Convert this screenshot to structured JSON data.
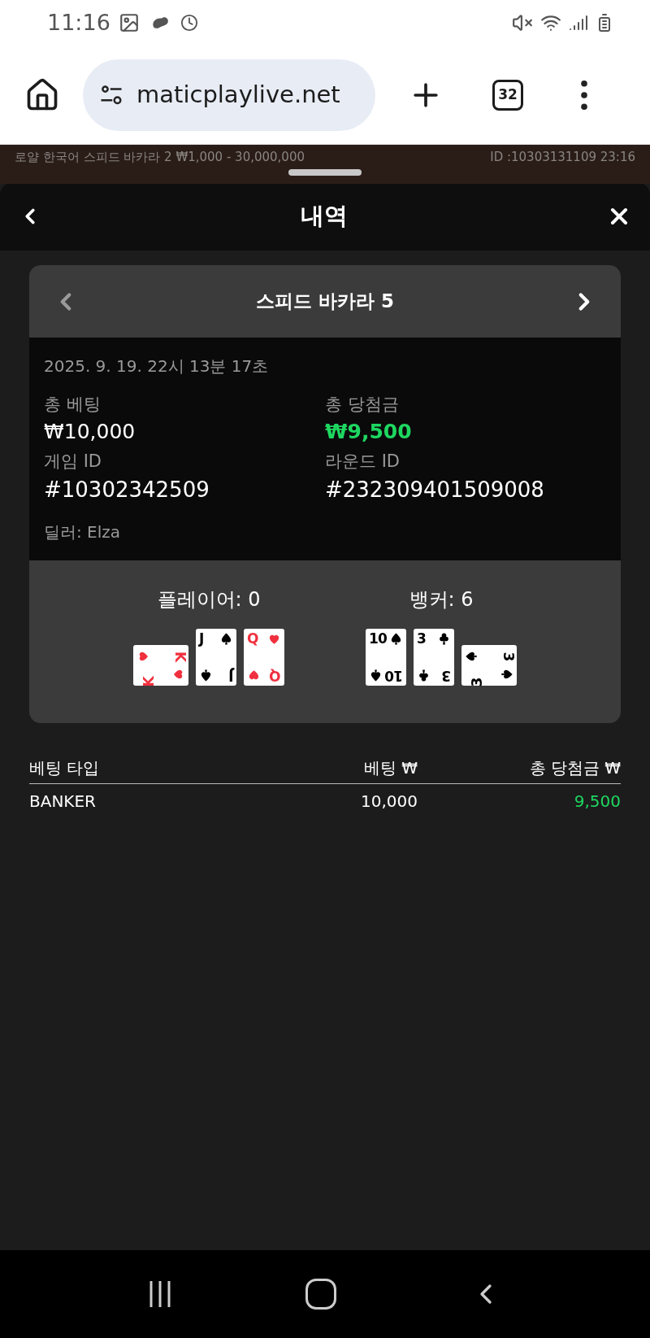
{
  "status_bar": {
    "time": "11:16"
  },
  "browser": {
    "url": "maticplaylive.net",
    "tab_count": "32"
  },
  "backdrop": {
    "table_info": "로얄 한국어 스피드 바카라 2 ₩1,000 - 30,000,000",
    "round_info": "ID :10303131109 23:16"
  },
  "sheet": {
    "title": "내역"
  },
  "game": {
    "title": "스피드 바카라 5",
    "datetime": "2025. 9. 19. 22시 13분 17초",
    "fields": [
      {
        "label": "총 베팅",
        "value": "₩10,000",
        "kind": "amount",
        "win": false
      },
      {
        "label": "총 당첨금",
        "value": "₩9,500",
        "kind": "amount",
        "win": true
      },
      {
        "label": "게임 ID",
        "value": "#10302342509",
        "kind": "id",
        "win": false
      },
      {
        "label": "라운드 ID",
        "value": "#232309401509008",
        "kind": "id",
        "win": false
      }
    ],
    "dealer": "딜러: Elza",
    "hands": [
      {
        "label": "플레이어: 0",
        "cards": [
          {
            "labels": [
              "K",
              "K"
            ],
            "kind": "heart",
            "rotated": true
          },
          {
            "labels": [
              "J",
              "J"
            ],
            "kind": "spade",
            "rotated": false
          },
          {
            "labels": [
              "Q",
              "Q"
            ],
            "kind": "heart",
            "rotated": false
          }
        ]
      },
      {
        "label": "뱅커: 6",
        "cards": [
          {
            "labels": [
              "10",
              "10"
            ],
            "kind": "spade",
            "rotated": false
          },
          {
            "labels": [
              "3",
              "3"
            ],
            "kind": "club",
            "rotated": false
          },
          {
            "labels": [
              "3",
              "3"
            ],
            "kind": "spade",
            "rotated": true
          }
        ]
      }
    ]
  },
  "bets": {
    "columns": [
      "베팅 타입",
      "베팅 ₩",
      "총 당첨금 ₩"
    ],
    "rows": [
      {
        "type": "BANKER",
        "bet": "10,000",
        "win": "9,500",
        "won": true
      }
    ]
  }
}
